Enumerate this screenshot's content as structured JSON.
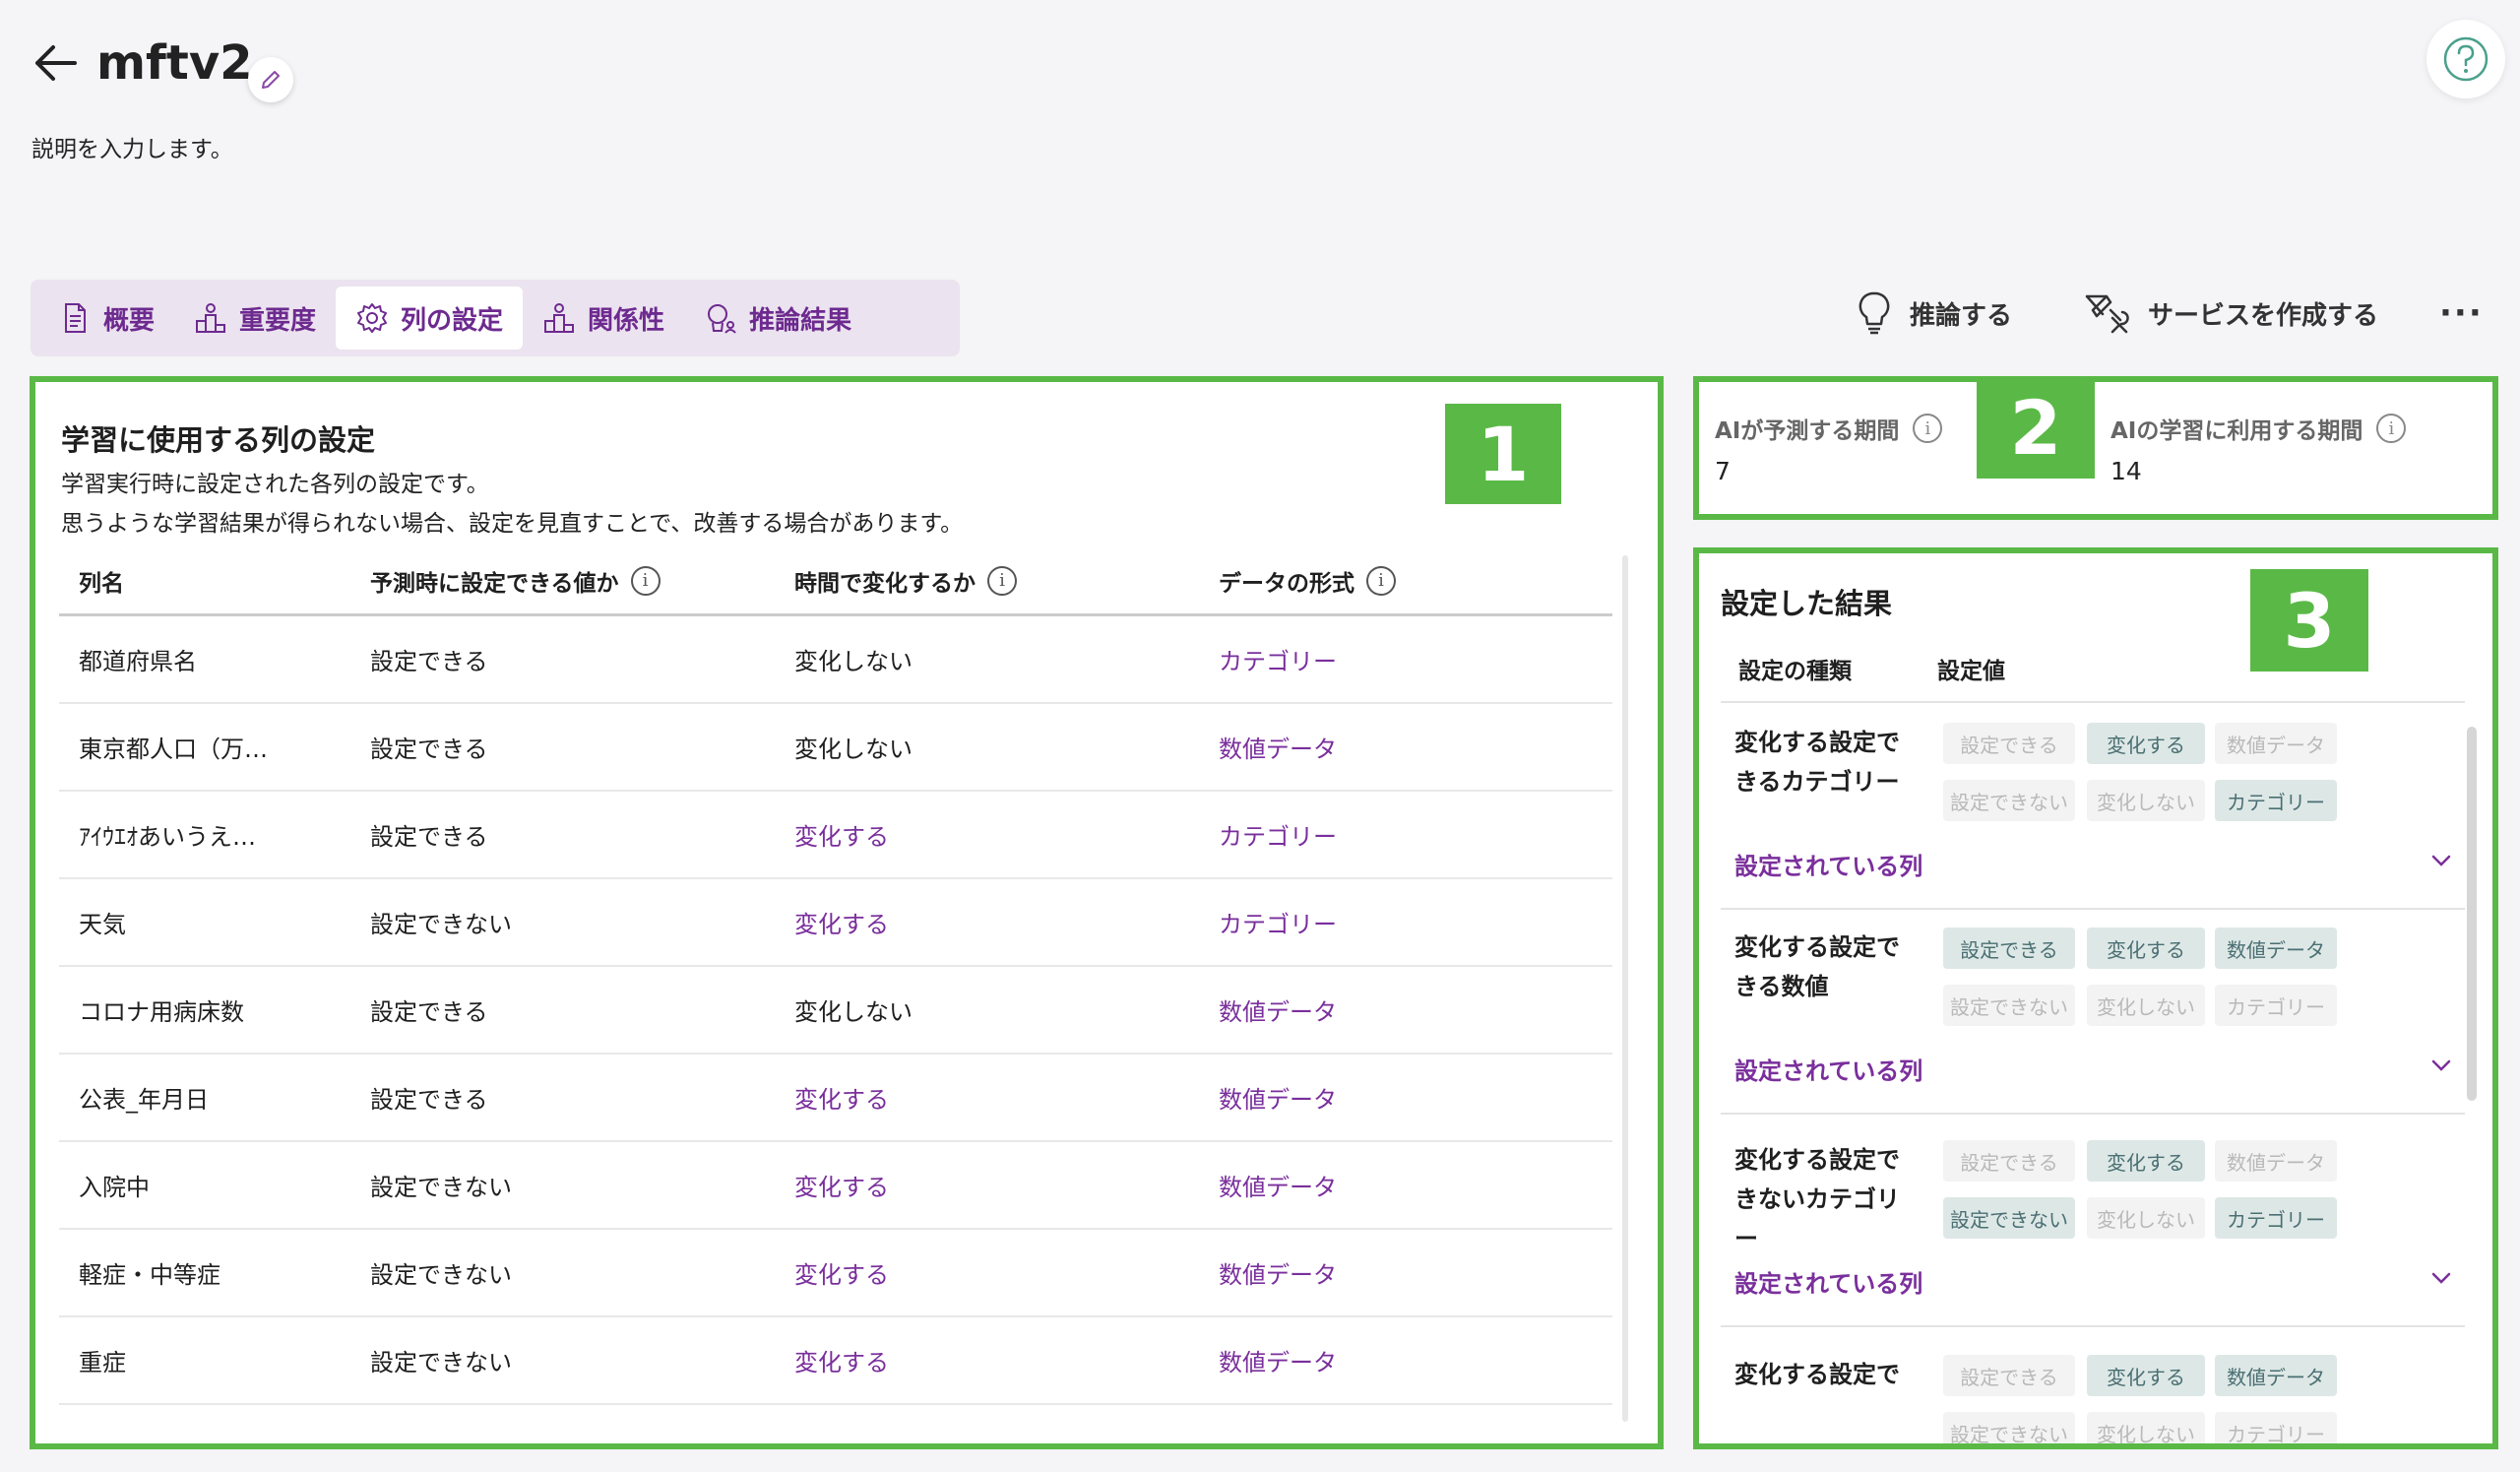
{
  "header": {
    "title": "mftv2",
    "description": "説明を入力します。"
  },
  "tabs": [
    {
      "label": "概要",
      "icon": "document-icon",
      "active": false
    },
    {
      "label": "重要度",
      "icon": "podium-icon",
      "active": false
    },
    {
      "label": "列の設定",
      "icon": "gear-icon",
      "active": true
    },
    {
      "label": "関係性",
      "icon": "relation-icon",
      "active": false
    },
    {
      "label": "推論結果",
      "icon": "bulb-person-icon",
      "active": false
    }
  ],
  "actions": {
    "infer": "推論する",
    "create_service": "サービスを作成する",
    "more": "···"
  },
  "badges": {
    "one": "1",
    "two": "2",
    "three": "3"
  },
  "panel1": {
    "title": "学習に使用する列の設定",
    "sub1": "学習実行時に設定された各列の設定です。",
    "sub2": "思うような学習結果が得られない場合、設定を見直すことで、改善する場合があります。",
    "headers": {
      "name": "列名",
      "settable": "予測時に設定できる値か",
      "changes": "時間で変化するか",
      "format": "データの形式"
    },
    "rows": [
      {
        "name": "都道府県名",
        "settable": "設定できる",
        "changes": "変化しない",
        "format": "カテゴリー"
      },
      {
        "name": "東京都人口（万…",
        "settable": "設定できる",
        "changes": "変化しない",
        "format": "数値データ"
      },
      {
        "name": "ｱｲｳｴｵあいうえ…",
        "settable": "設定できる",
        "changes": "変化する",
        "format": "カテゴリー"
      },
      {
        "name": "天気",
        "settable": "設定できない",
        "changes": "変化する",
        "format": "カテゴリー"
      },
      {
        "name": "コロナ用病床数",
        "settable": "設定できる",
        "changes": "変化しない",
        "format": "数値データ"
      },
      {
        "name": "公表_年月日",
        "settable": "設定できる",
        "changes": "変化する",
        "format": "数値データ"
      },
      {
        "name": "入院中",
        "settable": "設定できない",
        "changes": "変化する",
        "format": "数値データ"
      },
      {
        "name": "軽症・中等症",
        "settable": "設定できない",
        "changes": "変化する",
        "format": "数値データ"
      },
      {
        "name": "重症",
        "settable": "設定できない",
        "changes": "変化する",
        "format": "数値データ"
      }
    ]
  },
  "panel2": {
    "predict_label": "AIが予測する期間",
    "predict_value": "7",
    "learn_label": "AIの学習に利用する期間",
    "learn_value": "14"
  },
  "panel3": {
    "title": "設定した結果",
    "col_type": "設定の種類",
    "col_value": "設定値",
    "chip_labels": [
      "設定できる",
      "変化する",
      "数値データ",
      "設定できない",
      "変化しない",
      "カテゴリー"
    ],
    "columns_link": "設定されている列",
    "groups": [
      {
        "name": "変化する設定できるカテゴリー",
        "on": [
          false,
          true,
          false,
          false,
          false,
          true
        ]
      },
      {
        "name": "変化する設定できる数値",
        "on": [
          true,
          true,
          true,
          false,
          false,
          false
        ]
      },
      {
        "name": "変化する設定できないカテゴリー",
        "on": [
          false,
          true,
          false,
          true,
          false,
          true
        ]
      },
      {
        "name": "変化する設定で",
        "on": [
          false,
          true,
          true,
          false,
          false,
          false
        ]
      }
    ]
  },
  "colors": {
    "accent": "#7a2f9c",
    "highlight": "#5ab946",
    "chip_on": "#dde8e6"
  }
}
